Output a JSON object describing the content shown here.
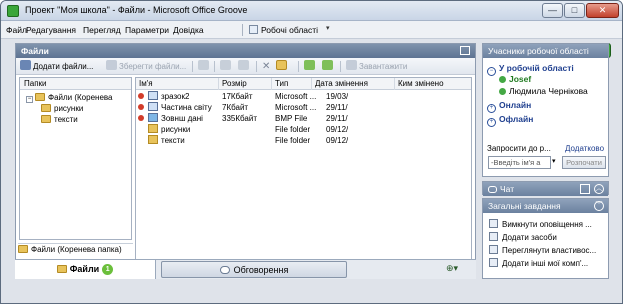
{
  "window": {
    "title": "Проект \"Моя школа\" - Файли - Microsoft Office Groove",
    "min_label": "—",
    "max_label": "□",
    "close_label": "✕"
  },
  "menu": {
    "items": [
      "Файл",
      "Редагування",
      "Перегляд",
      "Параметри",
      "Довідка"
    ],
    "workspaces_label": "Робочі області",
    "workspaces_arrow": "▾"
  },
  "files_panel": {
    "title": "Файли",
    "toolbar": {
      "add_files": "Додати файли...",
      "save_files": "Зберегти файли...",
      "download": "Завантажити"
    },
    "tree": {
      "header": "Папки",
      "items": [
        {
          "label": "Файли (Коренева",
          "expander": "−"
        },
        {
          "label": "рисунки"
        },
        {
          "label": "тексти"
        }
      ]
    },
    "columns": [
      "Ім'я",
      "Розмір",
      "Тип",
      "Дата змінення",
      "Ким змінено"
    ],
    "rows": [
      {
        "name": "зразок2",
        "size": "17Кбайт",
        "type": "Microsoft ...",
        "date": "19/03/",
        "modified_by": "",
        "flag": true,
        "icon": "doc-icon"
      },
      {
        "name": "Частина світу",
        "size": "7Кбайт",
        "type": "Microsoft ...",
        "date": "29/11/",
        "modified_by": "",
        "flag": true,
        "icon": "doc-icon"
      },
      {
        "name": "Зовнш  дані",
        "size": "335Кбайт",
        "type": "BMP File",
        "date": "29/11/",
        "modified_by": "",
        "flag": true,
        "icon": "image-icon"
      },
      {
        "name": "рисунки",
        "size": "",
        "type": "File folder",
        "date": "09/12/",
        "modified_by": "",
        "flag": false,
        "icon": "folder-icon"
      },
      {
        "name": "тексти",
        "size": "",
        "type": "File folder",
        "date": "09/12/",
        "modified_by": "",
        "flag": false,
        "icon": "folder-icon"
      }
    ],
    "current_path": "Файли (Коренева папка)"
  },
  "tabs": {
    "files_label": "Файли",
    "files_badge": "1",
    "discussion_label": "Обговорення",
    "extra_label": "▾"
  },
  "members": {
    "title": "Учасники робочої області",
    "in_workspace_label": "У робочій області",
    "in_workspace": [
      "Josef",
      "Людмила Чернікова"
    ],
    "online_label": "Онлайн",
    "offline_label": "Офлайн",
    "invite_label": "Запросити до р...",
    "more_label": "Додатково",
    "invite_placeholder": "-Введіть ім'я а",
    "invite_button": "Розпочати"
  },
  "chat": {
    "title": "Чат"
  },
  "tasks": {
    "title": "Загальні завдання",
    "items": [
      "Вимкнути оповіщення ...",
      "Додати засоби",
      "Переглянути властивос...",
      "Додати інші мої комп'..."
    ]
  }
}
